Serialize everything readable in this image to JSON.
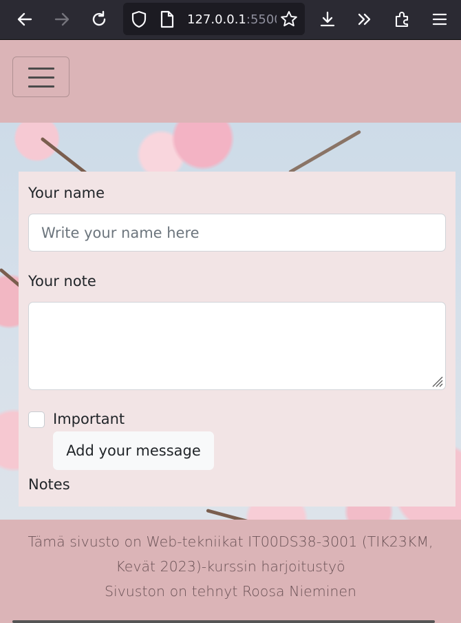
{
  "browser": {
    "url_main": "127.0.0.1",
    "url_port": ":5500"
  },
  "navbar": {
    "toggler_icon": "hamburger-menu-icon"
  },
  "form": {
    "name_label": "Your name",
    "name_placeholder": "Write your name here",
    "name_value": "",
    "note_label": "Your note",
    "note_value": "",
    "important_label": "Important",
    "important_checked": false,
    "submit_label": "Add your message",
    "notes_heading": "Notes"
  },
  "footer": {
    "line1": "Tämä sivusto on Web-tekniikat IT00DS38-3001 (TIK23KM,",
    "line2": "Kevät 2023)-kurssin harjoitustyö",
    "line3": "Sivuston on tehnyt Roosa Nieminen"
  },
  "colors": {
    "page_bg": "#dbb4b7",
    "card_bg": "#f2e4e5",
    "browser_bg": "#2b2a33",
    "text": "#212529",
    "footer_text": "#6b5256"
  }
}
